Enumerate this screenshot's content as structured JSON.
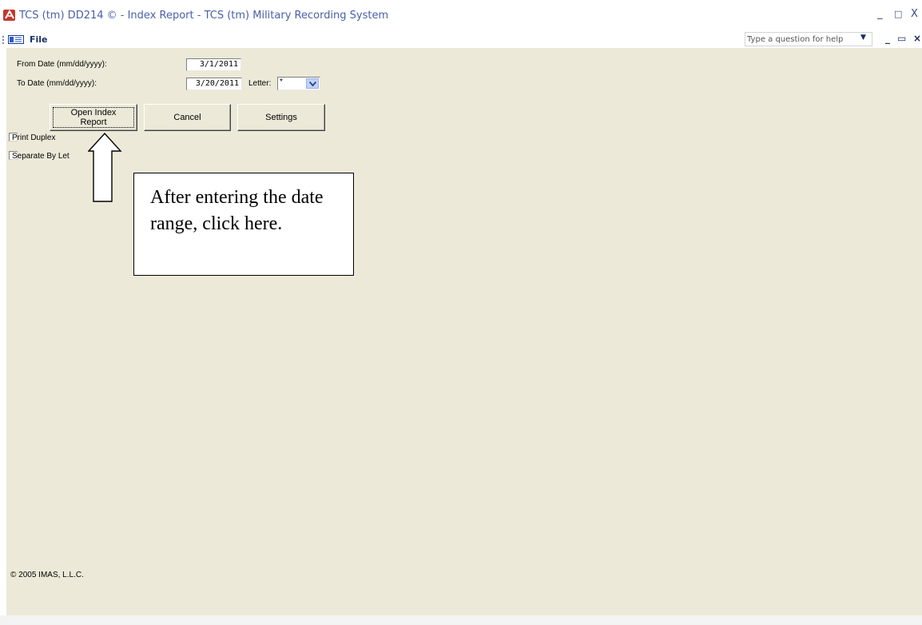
{
  "window": {
    "title": "TCS (tm) DD214 © - Index Report - TCS (tm) Military Recording System",
    "min_glyph": "_",
    "restore_glyph": "□",
    "close_glyph": "X"
  },
  "menubar": {
    "file_label": "File",
    "help_placeholder": "Type a question for help",
    "help_drop_glyph": "▼",
    "mdi_min": "_",
    "mdi_restore": "▭",
    "mdi_close": "×"
  },
  "form": {
    "from_label": "From Date (mm/dd/yyyy):",
    "from_value": "3/1/2011",
    "to_label": "To Date (mm/dd/yyyy):",
    "to_value": "3/20/2011",
    "letter_label": "Letter:",
    "letter_value": "*",
    "open_button": "Open Index Report",
    "cancel_button": "Cancel",
    "settings_button": "Settings",
    "print_duplex_label": "Print Duplex",
    "print_duplex_checked": false,
    "separate_label": "Separate By Let",
    "separate_checked": false
  },
  "callout": {
    "text": "After entering the date range, click here."
  },
  "footer": {
    "copyright": "© 2005 IMAS, L.L.C."
  },
  "colors": {
    "form_bg": "#ece9d8",
    "title_text": "#4a5fa8",
    "combo_button": "#c1d3fb"
  }
}
